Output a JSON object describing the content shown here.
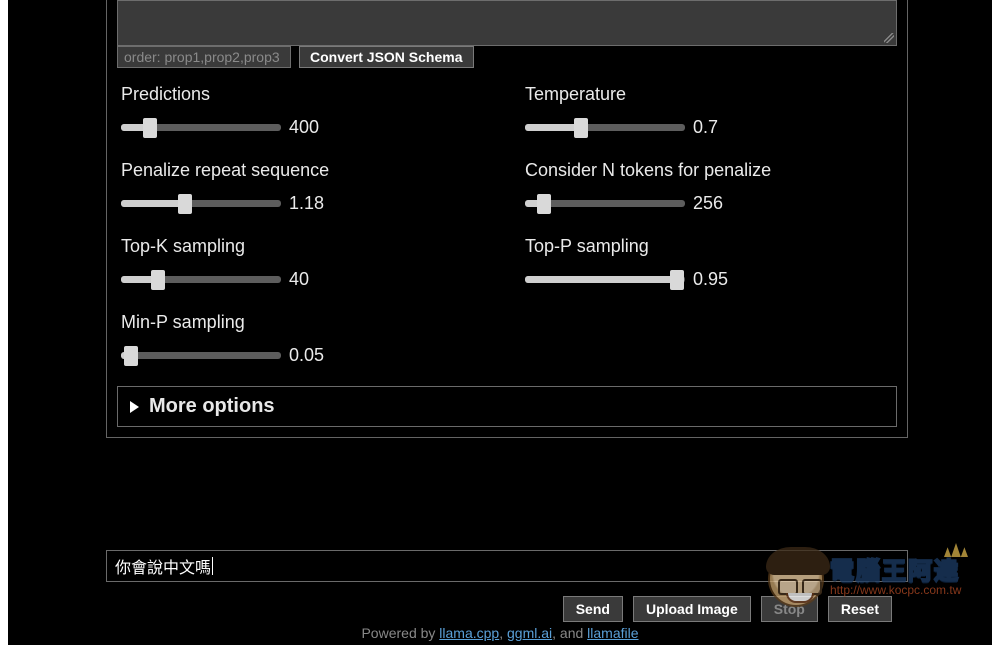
{
  "schema": {
    "order_placeholder": "order: prop1,prop2,prop3",
    "convert_label": "Convert JSON Schema"
  },
  "sliders": {
    "predictions": {
      "label": "Predictions",
      "value": 400,
      "pct": 18
    },
    "temperature": {
      "label": "Temperature",
      "value": 0.7,
      "pct": 35
    },
    "penalize_repeat": {
      "label": "Penalize repeat sequence",
      "value": 1.18,
      "pct": 40
    },
    "consider_n": {
      "label": "Consider N tokens for penalize",
      "value": 256,
      "pct": 12
    },
    "top_k": {
      "label": "Top-K sampling",
      "value": 40,
      "pct": 23
    },
    "top_p": {
      "label": "Top-P sampling",
      "value": 0.95,
      "pct": 95
    },
    "min_p": {
      "label": "Min-P sampling",
      "value": 0.05,
      "pct": 6
    }
  },
  "more_options_label": "More options",
  "prompt": {
    "text": "你會說中文嗎"
  },
  "buttons": {
    "send": "Send",
    "upload": "Upload Image",
    "stop": "Stop",
    "reset": "Reset"
  },
  "footer": {
    "prefix": "Powered by ",
    "links": [
      "llama.cpp",
      "ggml.ai",
      "llamafile"
    ],
    "sep": ", ",
    "and": ", and "
  },
  "watermark": {
    "title": "電腦王阿達",
    "url": "http://www.kocpc.com.tw"
  }
}
